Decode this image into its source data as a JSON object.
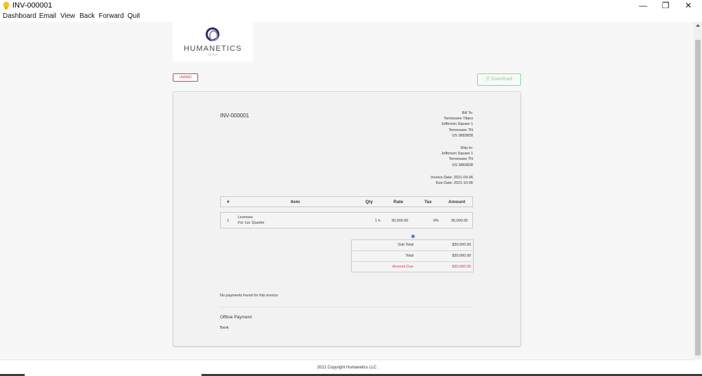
{
  "window": {
    "title": "INV-000001",
    "minimize": "—",
    "restore": "❐",
    "close": "✕"
  },
  "menu": [
    "Dashboard",
    "Email",
    "View",
    "Back",
    "Forward",
    "Quit"
  ],
  "logo": {
    "name": "HUMANETICS",
    "sub": "GROUP"
  },
  "status_badge": "UNPAID",
  "download_label": "🗎 Download",
  "invoice": {
    "number": "INV-000001",
    "bill_to": {
      "label": "Bill To:",
      "lines": [
        "Tennessee Titans",
        "Jefferson Square 1",
        "Tennessee TN",
        "US 3883828"
      ]
    },
    "ship_to": {
      "label": "Ship to:",
      "lines": [
        "Jefferson Square 1",
        "Tennessee TN",
        "US 3883828"
      ]
    },
    "invoice_date": "Invoice Date: 2021-09-06",
    "due_date": "Due Date: 2021-10-06",
    "table": {
      "headers": [
        "#",
        "Item",
        "Qty",
        "Rate",
        "Tax",
        "Amount"
      ],
      "rows": [
        {
          "num": "1",
          "item": "Licenses",
          "desc": "For 1st. Quarter",
          "qty": "1 h",
          "rate": "30,000.00",
          "tax": "0%",
          "amount": "30,000.00"
        }
      ]
    },
    "totals": {
      "subtotal_label": "Sub Total",
      "subtotal": "$30,000.00",
      "total_label": "Total",
      "total": "$30,000.00",
      "due_label": "Amount Due",
      "due": "$30,000.00"
    },
    "no_payments": "No payments found for this invoice",
    "offline_label": "Offline Payment",
    "offline_method": "Bank"
  },
  "footer": "2021 Copyright Humanetics LLC",
  "colors": {
    "danger": "#dc3545",
    "success": "#8fd19e",
    "logo": "#2e2a5e"
  }
}
